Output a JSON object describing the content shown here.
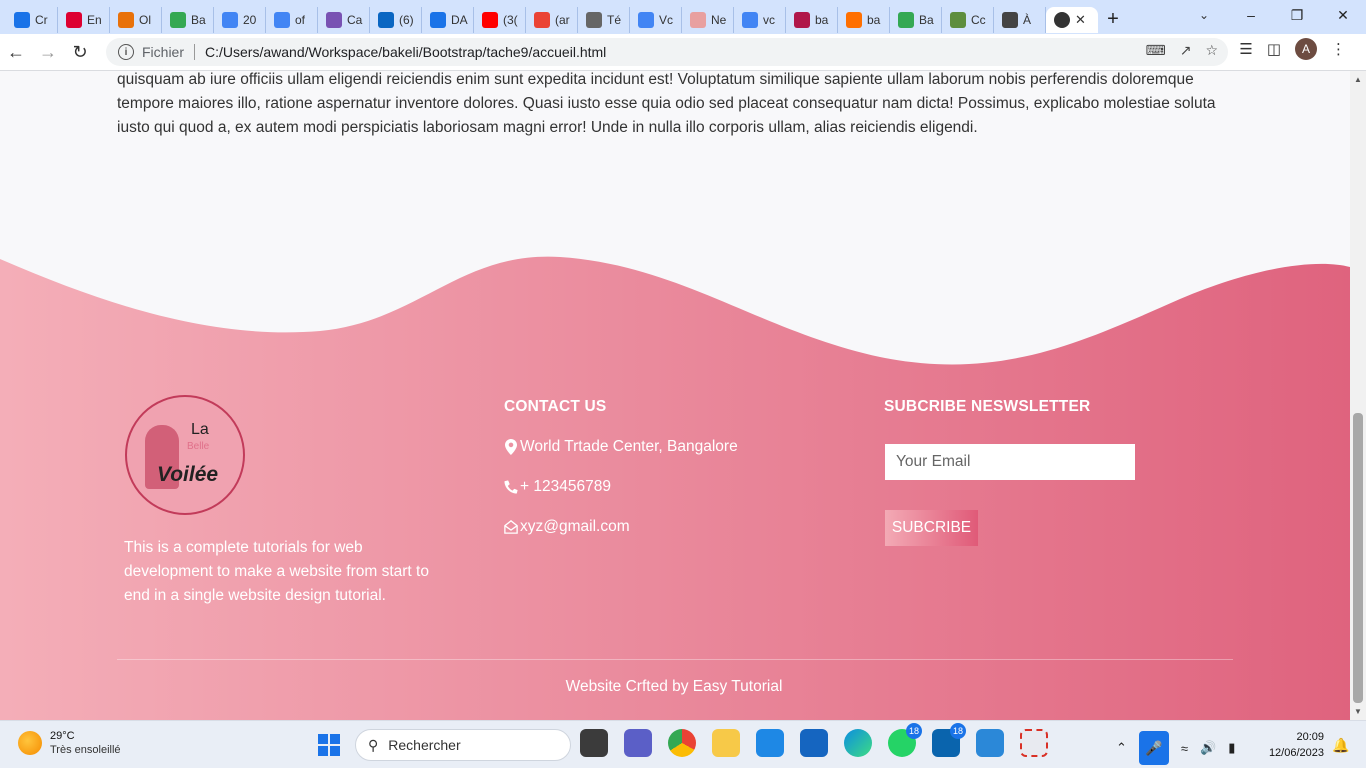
{
  "browser": {
    "tabs": [
      {
        "label": "Cr",
        "icon": "chrome-icon",
        "color": "#1a73e8"
      },
      {
        "label": "En",
        "icon": "angular-icon",
        "color": "#dd0031"
      },
      {
        "label": "Ol",
        "icon": "cloud-icon",
        "color": "#e8710a"
      },
      {
        "label": "Ba",
        "icon": "bakeli-icon",
        "color": "#34a853"
      },
      {
        "label": "20",
        "icon": "docs-icon",
        "color": "#4285f4"
      },
      {
        "label": "of",
        "icon": "google-icon",
        "color": "#4285f4"
      },
      {
        "label": "Ca",
        "icon": "bootstrap-icon",
        "color": "#7952b3"
      },
      {
        "label": "(6)",
        "icon": "linkedin-icon",
        "color": "#0a66c2"
      },
      {
        "label": "DA",
        "icon": "doc-icon",
        "color": "#1a73e8"
      },
      {
        "label": "(3(",
        "icon": "youtube-icon",
        "color": "#ff0000"
      },
      {
        "label": "(ar",
        "icon": "gmail-icon",
        "color": "#ea4335"
      },
      {
        "label": "Té",
        "icon": "graduation-icon",
        "color": "#666666"
      },
      {
        "label": "Vc",
        "icon": "google-icon",
        "color": "#4285f4"
      },
      {
        "label": "Ne",
        "icon": "notion-icon",
        "color": "#e8a0a0"
      },
      {
        "label": "vc",
        "icon": "google-icon",
        "color": "#4285f4"
      },
      {
        "label": "ba",
        "icon": "tag-icon",
        "color": "#b0174a"
      },
      {
        "label": "ba",
        "icon": "w3-icon",
        "color": "#ff6f00"
      },
      {
        "label": "Ba",
        "icon": "bakeli-icon",
        "color": "#34a853"
      },
      {
        "label": "Cc",
        "icon": "shopify-icon",
        "color": "#5e8e3e"
      },
      {
        "label": "À",
        "icon": "mosque-icon",
        "color": "#444444"
      }
    ],
    "active_tab_icon": "globe-icon",
    "address": {
      "scheme_label": "Fichier",
      "url": "C:/Users/awand/Workspace/bakeli/Bootstrap/tache9/accueil.html"
    },
    "profile_initial": "A"
  },
  "page": {
    "paragraph": "quisquam ab iure officiis ullam eligendi reiciendis enim sunt expedita incidunt est! Voluptatum similique sapiente ullam laborum nobis perferendis doloremque tempore maiores illo, ratione aspernatur inventore dolores. Quasi iusto esse quia odio sed placeat consequatur nam dicta! Possimus, explicabo molestiae soluta iusto qui quod a, ex autem modi perspiciatis laboriosam magni error! Unde in nulla illo corporis ullam, alias reiciendis eligendi.",
    "footer": {
      "logo": {
        "la": "La",
        "belle": "Belle",
        "voilee": "Voilée"
      },
      "about": "This is a complete tutorials for web development to make a website from start to end in a single website design tutorial.",
      "contact": {
        "title": "CONTACT US",
        "address": "World Trtade Center, Bangalore",
        "phone": "+ 123456789",
        "email": "xyz@gmail.com"
      },
      "newsletter": {
        "title": "SUBCRIBE NESWSLETTER",
        "placeholder": "Your Email",
        "button": "SUBCRIBE"
      },
      "credit": "Website Crfted by Easy Tutorial"
    },
    "colors": {
      "footer_left": "#f4aeb8",
      "footer_right": "#df637e",
      "page_bg": "#f8f8fa"
    }
  },
  "taskbar": {
    "weather": {
      "temp": "29°C",
      "desc": "Très ensoleillé"
    },
    "search_placeholder": "Rechercher",
    "badges": {
      "whatsapp": "18",
      "mail": "18"
    },
    "clock": {
      "time": "20:09",
      "date": "12/06/2023"
    }
  }
}
